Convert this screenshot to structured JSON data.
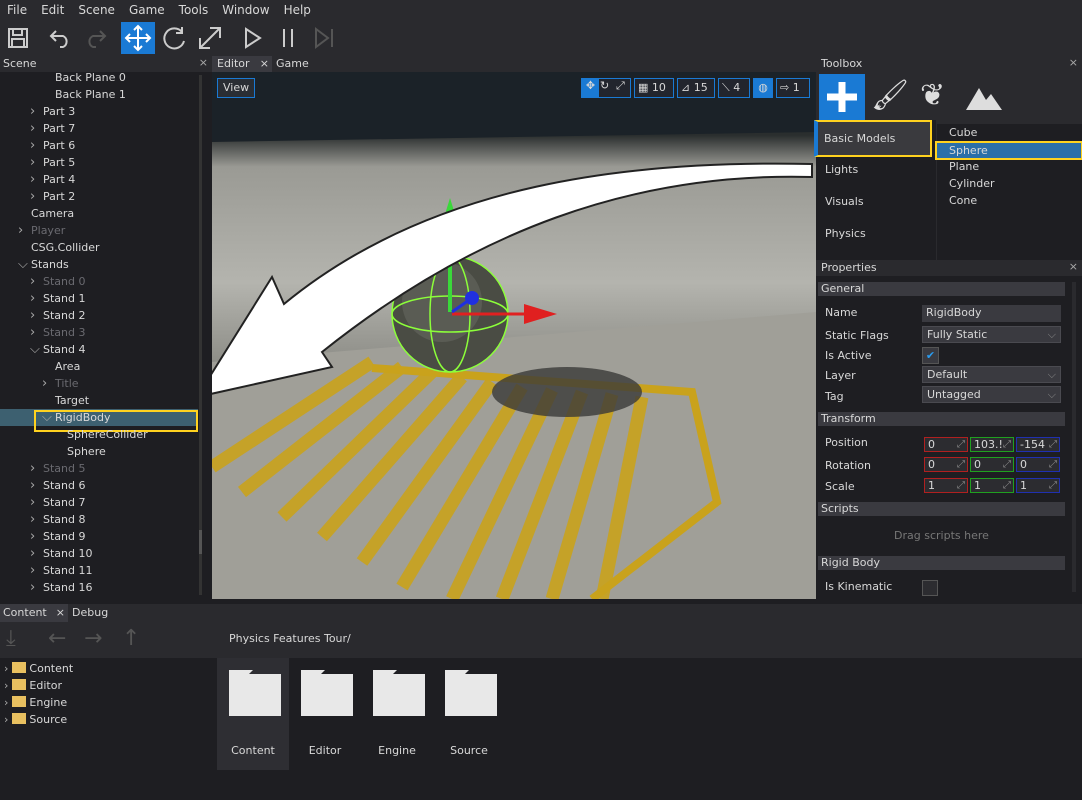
{
  "menu": [
    "File",
    "Edit",
    "Scene",
    "Game",
    "Tools",
    "Window",
    "Help"
  ],
  "toolbar": {
    "icons": [
      "save-icon",
      "undo-icon",
      "redo-icon",
      "translate-icon",
      "rotate-icon",
      "scale-icon",
      "play-icon",
      "pause-icon",
      "step-icon"
    ],
    "active": "translate-icon"
  },
  "scene_panel": {
    "title": "Scene",
    "close": "×",
    "items": [
      {
        "label": "Back Plane 0",
        "level": 3,
        "arrow": "",
        "dim": false
      },
      {
        "label": "Back Plane 1",
        "level": 3,
        "arrow": "",
        "dim": false
      },
      {
        "label": "Part 3",
        "level": 2,
        "arrow": ">",
        "dim": false
      },
      {
        "label": "Part 7",
        "level": 2,
        "arrow": ">",
        "dim": false
      },
      {
        "label": "Part 6",
        "level": 2,
        "arrow": ">",
        "dim": false
      },
      {
        "label": "Part 5",
        "level": 2,
        "arrow": ">",
        "dim": false
      },
      {
        "label": "Part 4",
        "level": 2,
        "arrow": ">",
        "dim": false
      },
      {
        "label": "Part 2",
        "level": 2,
        "arrow": ">",
        "dim": false
      },
      {
        "label": "Camera",
        "level": 1,
        "arrow": "",
        "dim": false
      },
      {
        "label": "Player",
        "level": 1,
        "arrow": ">",
        "dim": true
      },
      {
        "label": "CSG.Collider",
        "level": 1,
        "arrow": "",
        "dim": false
      },
      {
        "label": "Stands",
        "level": 1,
        "arrow": "v",
        "dim": false
      },
      {
        "label": "Stand 0",
        "level": 2,
        "arrow": ">",
        "dim": true
      },
      {
        "label": "Stand 1",
        "level": 2,
        "arrow": ">",
        "dim": false
      },
      {
        "label": "Stand 2",
        "level": 2,
        "arrow": ">",
        "dim": false
      },
      {
        "label": "Stand 3",
        "level": 2,
        "arrow": ">",
        "dim": true
      },
      {
        "label": "Stand 4",
        "level": 2,
        "arrow": "v",
        "dim": false
      },
      {
        "label": "Area",
        "level": 3,
        "arrow": "",
        "dim": false
      },
      {
        "label": "Title",
        "level": 3,
        "arrow": ">",
        "dim": true
      },
      {
        "label": "Target",
        "level": 3,
        "arrow": "",
        "dim": false
      },
      {
        "label": "RigidBody",
        "level": 3,
        "arrow": "v",
        "dim": false,
        "selected": true
      },
      {
        "label": "SphereCollider",
        "level": 4,
        "arrow": "",
        "dim": false
      },
      {
        "label": "Sphere",
        "level": 4,
        "arrow": "",
        "dim": false
      },
      {
        "label": "Stand 5",
        "level": 2,
        "arrow": ">",
        "dim": true
      },
      {
        "label": "Stand 6",
        "level": 2,
        "arrow": ">",
        "dim": false
      },
      {
        "label": "Stand 7",
        "level": 2,
        "arrow": ">",
        "dim": false
      },
      {
        "label": "Stand 8",
        "level": 2,
        "arrow": ">",
        "dim": false
      },
      {
        "label": "Stand 9",
        "level": 2,
        "arrow": ">",
        "dim": false
      },
      {
        "label": "Stand 10",
        "level": 2,
        "arrow": ">",
        "dim": false
      },
      {
        "label": "Stand 11",
        "level": 2,
        "arrow": ">",
        "dim": false
      },
      {
        "label": "Stand 16",
        "level": 2,
        "arrow": ">",
        "dim": false
      }
    ]
  },
  "viewport": {
    "tabs": [
      "Editor",
      "Game"
    ],
    "close": "×",
    "view_button": "View",
    "grid_snap": "10",
    "rotate_snap": "15",
    "scale_snap": "4",
    "camera_speed": "1"
  },
  "toolbox": {
    "title": "Toolbox",
    "close": "×",
    "categories": [
      "Basic Models",
      "Lights",
      "Visuals",
      "Physics"
    ],
    "selected_category": "Basic Models",
    "items": [
      "Cube",
      "Sphere",
      "Plane",
      "Cylinder",
      "Cone"
    ],
    "selected_item": "Sphere"
  },
  "properties": {
    "title": "Properties",
    "close": "×",
    "general": "General",
    "name_label": "Name",
    "name": "RigidBody",
    "static_flags_label": "Static Flags",
    "static_flags": "Fully Static",
    "is_active_label": "Is Active",
    "is_active": true,
    "layer_label": "Layer",
    "layer": "Default",
    "tag_label": "Tag",
    "tag": "Untagged",
    "transform": "Transform",
    "position_label": "Position",
    "position": [
      "0",
      "103.!",
      "-154"
    ],
    "rotation_label": "Rotation",
    "rotation": [
      "0",
      "0",
      "0"
    ],
    "scale_label": "Scale",
    "scale": [
      "1",
      "1",
      "1"
    ],
    "scripts": "Scripts",
    "drag_scripts": "Drag scripts here",
    "rigid_body": "Rigid Body",
    "is_kinematic_label": "Is Kinematic",
    "is_kinematic": false
  },
  "content": {
    "tabs": [
      "Content",
      "Debug"
    ],
    "close": "×",
    "path": "Physics Features Tour/",
    "tree": [
      "Content",
      "Editor",
      "Engine",
      "Source"
    ],
    "folders": [
      "Content",
      "Editor",
      "Engine",
      "Source"
    ],
    "selected_folder": "Content"
  },
  "colors": {
    "accent": "#1a7ad4",
    "selection": "#ffd21f",
    "x_axis": "#c02020",
    "y_axis": "#20a020",
    "z_axis": "#2030c0"
  }
}
